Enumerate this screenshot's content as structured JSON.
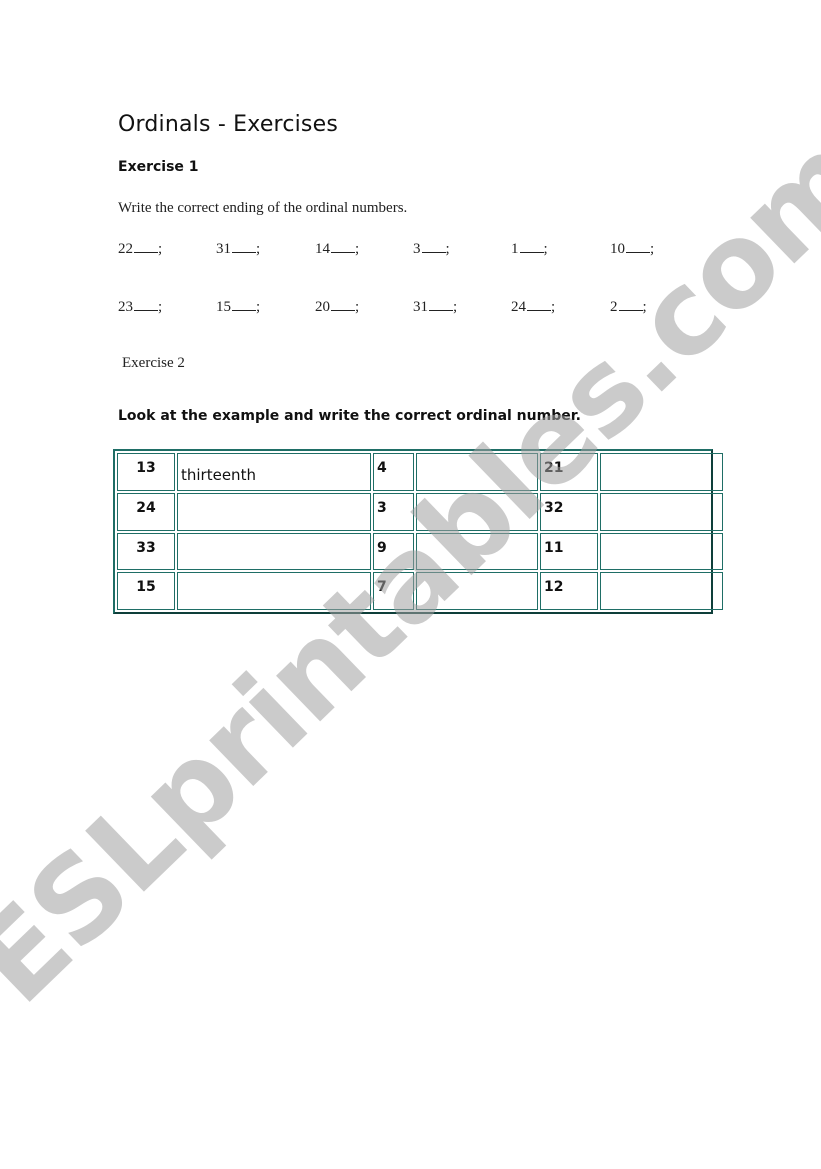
{
  "document": {
    "title": "Ordinals - Exercises",
    "exercise1": {
      "heading": "Exercise 1",
      "instruction": "Write the correct ending of the ordinal numbers.",
      "rows": [
        [
          {
            "number": "22",
            "suffix": ";"
          },
          {
            "number": "31",
            "suffix": ";"
          },
          {
            "number": "14",
            "suffix": ";"
          },
          {
            "number": "3",
            "suffix": ";"
          },
          {
            "number": "1",
            "suffix": ";"
          },
          {
            "number": "10",
            "suffix": ";"
          }
        ],
        [
          {
            "number": "23",
            "suffix": ";"
          },
          {
            "number": "15",
            "suffix": ";"
          },
          {
            "number": "20",
            "suffix": ";"
          },
          {
            "number": "31",
            "suffix": ";"
          },
          {
            "number": "24",
            "suffix": ";"
          },
          {
            "number": "2",
            "suffix": ";"
          }
        ]
      ]
    },
    "exercise2": {
      "heading": "Exercise 2",
      "instruction": "Look at the example and write the correct ordinal number.",
      "table": [
        [
          "13",
          "thirteenth",
          "4",
          "",
          "21",
          ""
        ],
        [
          "24",
          "",
          "3",
          "",
          "32",
          ""
        ],
        [
          "33",
          "",
          "9",
          "",
          "11",
          ""
        ],
        [
          "15",
          "",
          "7",
          "",
          "12",
          ""
        ]
      ]
    },
    "watermark": "ESLprintables.com",
    "colors": {
      "table_border": "#1f6e66",
      "watermark": "#a0a0a0"
    }
  }
}
